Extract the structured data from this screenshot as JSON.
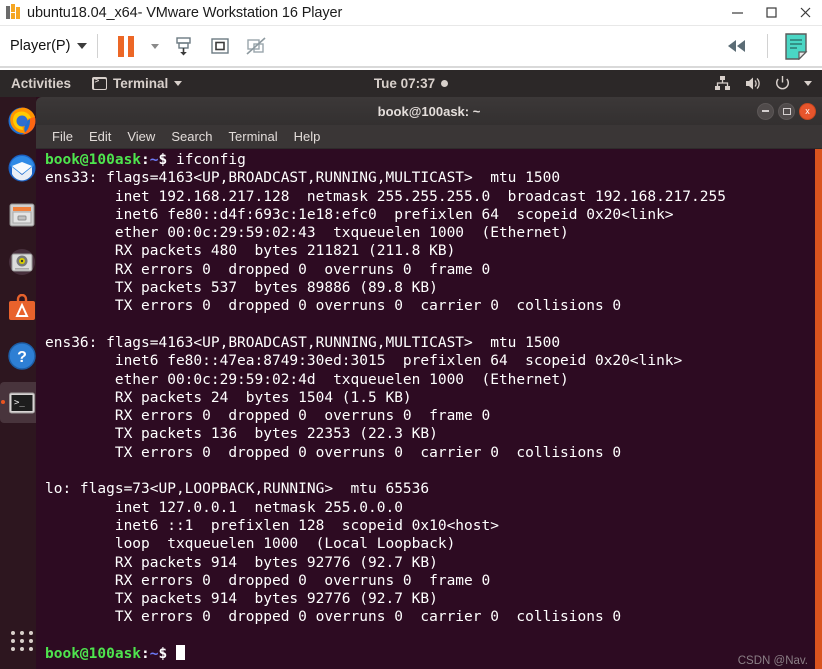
{
  "vmware": {
    "window_title": "ubuntu18.04_x64- VMware Workstation 16 Player",
    "logo_icon": "vmware-logo-icon",
    "window_buttons": [
      {
        "name": "minimize-button",
        "icon": "minimize-icon",
        "label": "—"
      },
      {
        "name": "maximize-button",
        "icon": "maximize-icon",
        "label": "□"
      },
      {
        "name": "close-button",
        "icon": "close-icon",
        "label": "✕"
      }
    ],
    "toolbar": {
      "player_menu_label": "Player(P)",
      "player_menu_caret": "chevron-down-icon",
      "buttons": [
        {
          "name": "pause-vm-button",
          "icon": "pause-icon",
          "tooltip": "Suspend"
        },
        {
          "name": "pause-dropdown-button",
          "icon": "chevron-down-small-icon",
          "tooltip": "Power options"
        },
        {
          "name": "send-ctrl-alt-del-button",
          "icon": "send-key-icon",
          "tooltip": "Send Key"
        },
        {
          "name": "fullscreen-button",
          "icon": "fullscreen-icon",
          "tooltip": "Enter full screen"
        },
        {
          "name": "unity-mode-button",
          "icon": "unity-mode-disabled-icon",
          "tooltip": "Unity mode"
        }
      ],
      "right_buttons": [
        {
          "name": "collapse-toolbar-button",
          "icon": "rewind-double-left-icon",
          "label": "«"
        },
        {
          "name": "notes-button",
          "icon": "sticky-note-icon",
          "tooltip": "Notes"
        }
      ]
    }
  },
  "ubuntu": {
    "topbar": {
      "activities_label": "Activities",
      "app_menu_label": "Terminal",
      "app_menu_icon": "terminal-icon",
      "app_menu_caret": "chevron-down-icon",
      "clock": "Tue 07:37",
      "clock_dot": "notification-dot-icon",
      "tray_icons": [
        {
          "name": "network-icon",
          "label": "network"
        },
        {
          "name": "volume-icon",
          "label": "volume"
        },
        {
          "name": "power-icon",
          "label": "power"
        },
        {
          "name": "chevron-down-icon",
          "label": "system menu"
        }
      ]
    },
    "dock": {
      "items": [
        {
          "name": "dock-item-firefox",
          "label": "Firefox",
          "icon": "firefox-icon",
          "active": false
        },
        {
          "name": "dock-item-thunderbird",
          "label": "Thunderbird Mail",
          "icon": "thunderbird-icon",
          "active": false
        },
        {
          "name": "dock-item-files",
          "label": "Files",
          "icon": "files-icon",
          "active": false
        },
        {
          "name": "dock-item-rhythmbox",
          "label": "Rhythmbox",
          "icon": "rhythmbox-icon",
          "active": false
        },
        {
          "name": "dock-item-software",
          "label": "Ubuntu Software",
          "icon": "ubuntu-software-icon",
          "active": false
        },
        {
          "name": "dock-item-help",
          "label": "Help",
          "icon": "help-icon",
          "active": false
        },
        {
          "name": "dock-item-terminal",
          "label": "Terminal",
          "icon": "terminal-icon",
          "active": true
        }
      ],
      "show_apps": {
        "name": "show-applications-button",
        "icon": "app-grid-icon"
      }
    }
  },
  "terminal": {
    "title": "book@100ask: ~",
    "window_buttons": [
      {
        "name": "terminal-minimize-button",
        "icon": "minimize-icon"
      },
      {
        "name": "terminal-maximize-button",
        "icon": "maximize-icon"
      },
      {
        "name": "terminal-close-button",
        "icon": "close-icon",
        "label": "x"
      }
    ],
    "menu": [
      "File",
      "Edit",
      "View",
      "Search",
      "Terminal",
      "Help"
    ],
    "prompt": {
      "user_host": "book@100ask",
      "colon": ":",
      "path": "~",
      "sigil": "$"
    },
    "command": "ifconfig",
    "output_lines": [
      "ens33: flags=4163<UP,BROADCAST,RUNNING,MULTICAST>  mtu 1500",
      "        inet 192.168.217.128  netmask 255.255.255.0  broadcast 192.168.217.255",
      "        inet6 fe80::d4f:693c:1e18:efc0  prefixlen 64  scopeid 0x20<link>",
      "        ether 00:0c:29:59:02:43  txqueuelen 1000  (Ethernet)",
      "        RX packets 480  bytes 211821 (211.8 KB)",
      "        RX errors 0  dropped 0  overruns 0  frame 0",
      "        TX packets 537  bytes 89886 (89.8 KB)",
      "        TX errors 0  dropped 0 overruns 0  carrier 0  collisions 0",
      "",
      "ens36: flags=4163<UP,BROADCAST,RUNNING,MULTICAST>  mtu 1500",
      "        inet6 fe80::47ea:8749:30ed:3015  prefixlen 64  scopeid 0x20<link>",
      "        ether 00:0c:29:59:02:4d  txqueuelen 1000  (Ethernet)",
      "        RX packets 24  bytes 1504 (1.5 KB)",
      "        RX errors 0  dropped 0  overruns 0  frame 0",
      "        TX packets 136  bytes 22353 (22.3 KB)",
      "        TX errors 0  dropped 0 overruns 0  carrier 0  collisions 0",
      "",
      "lo: flags=73<UP,LOOPBACK,RUNNING>  mtu 65536",
      "        inet 127.0.0.1  netmask 255.0.0.0",
      "        inet6 ::1  prefixlen 128  scopeid 0x10<host>",
      "        loop  txqueuelen 1000  (Local Loopback)",
      "        RX packets 914  bytes 92776 (92.7 KB)",
      "        RX errors 0  dropped 0  overruns 0  frame 0",
      "        TX packets 914  bytes 92776 (92.7 KB)",
      "        TX errors 0  dropped 0 overruns 0  carrier 0  collisions 0",
      ""
    ],
    "cursor": "block-cursor",
    "scrollbar": {
      "name": "terminal-scrollbar",
      "color": "#d9541f"
    },
    "watermark": "CSDN @Nav."
  },
  "colors": {
    "accent_orange": "#e95420",
    "terminal_bg": "#2d0b22",
    "topbar_bg": "#2c2828",
    "prompt_green": "#4ee44e",
    "prompt_blue": "#6d7bf7"
  }
}
